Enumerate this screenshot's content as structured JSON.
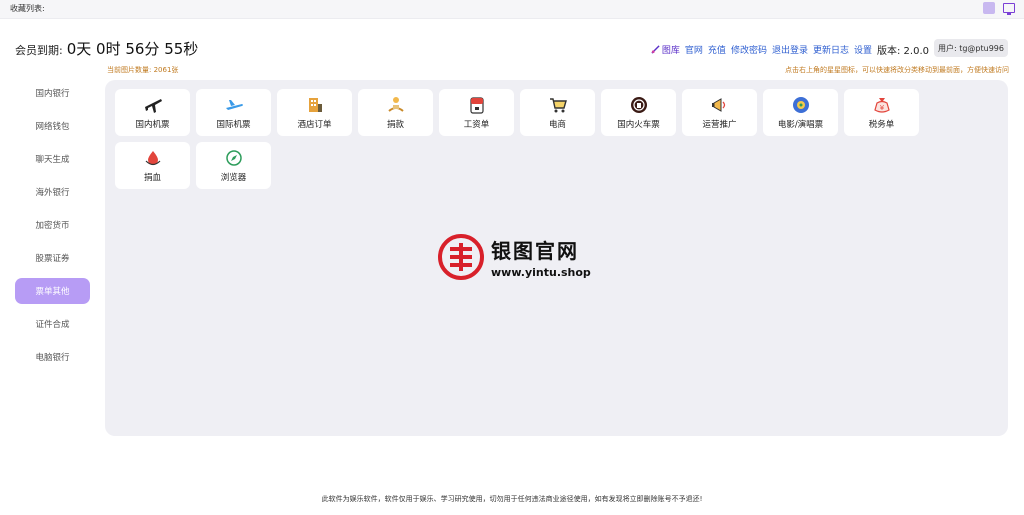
{
  "topbar": {
    "favorites_label": "收藏列表:"
  },
  "header": {
    "member_label": "会员到期:",
    "member_time": "0天 0时 56分 55秒",
    "links": {
      "gallery": "图库",
      "official": "官网",
      "recharge": "充值",
      "change_password": "修改密码",
      "logout": "退出登录",
      "changelog": "更新日志",
      "settings": "设置"
    },
    "version": "版本: 2.0.0",
    "user": "用户: tg@ptu996"
  },
  "info": {
    "image_count": "当前图片数量: 2061张",
    "hint": "点击右上角的星星图标，可以快速将改分类移动到最前面，方便快速访问"
  },
  "sidebar": {
    "items": [
      {
        "label": "国内银行"
      },
      {
        "label": "网络钱包"
      },
      {
        "label": "聊天生成"
      },
      {
        "label": "海外银行"
      },
      {
        "label": "加密货币"
      },
      {
        "label": "股票证券"
      },
      {
        "label": "票单其他"
      },
      {
        "label": "证件合成"
      },
      {
        "label": "电脑银行"
      }
    ],
    "active_index": 6
  },
  "tiles": [
    {
      "label": "国内机票",
      "icon": "airplane-icon"
    },
    {
      "label": "国际机票",
      "icon": "airplane-blue-icon"
    },
    {
      "label": "酒店订单",
      "icon": "hotel-icon"
    },
    {
      "label": "捐款",
      "icon": "donate-icon"
    },
    {
      "label": "工资单",
      "icon": "payroll-icon"
    },
    {
      "label": "电商",
      "icon": "shopping-cart-icon"
    },
    {
      "label": "国内火车票",
      "icon": "railway-icon"
    },
    {
      "label": "运营推广",
      "icon": "megaphone-icon"
    },
    {
      "label": "电影/演唱票",
      "icon": "film-icon"
    },
    {
      "label": "税务单",
      "icon": "tax-bag-icon"
    },
    {
      "label": "捐血",
      "icon": "blood-drop-icon"
    },
    {
      "label": "浏览器",
      "icon": "compass-icon"
    }
  ],
  "watermark": {
    "title": "银图官网",
    "url": "www.yintu.shop"
  },
  "footer": {
    "disclaimer": "此软件为娱乐软件，软件仅用于娱乐、学习研究使用，切勿用于任何违法商业途径使用，如有发现将立即删除账号不予退还!"
  },
  "colors": {
    "accent": "#b79cf5",
    "link": "#2f5fd0",
    "hint": "#c07a20",
    "watermark_red": "#d8202a"
  }
}
